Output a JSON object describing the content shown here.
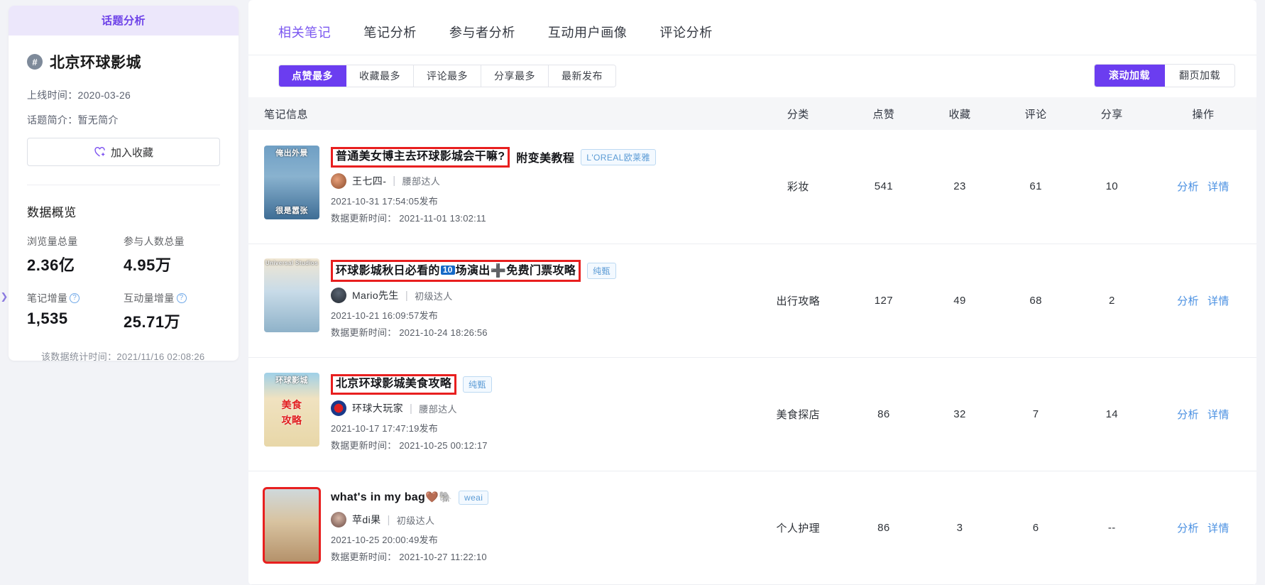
{
  "sidebar": {
    "header_title": "话题分析",
    "topic": {
      "hash_icon": "hash-icon",
      "name": "北京环球影城"
    },
    "online_time_label": "上线时间：",
    "online_time_value": "2020-03-26",
    "intro_label": "话题简介：",
    "intro_value": "暂无简介",
    "favorite_button": "加入收藏",
    "overview_title": "数据概览",
    "stats": [
      {
        "label": "浏览量总量",
        "value": "2.36亿",
        "has_help": false
      },
      {
        "label": "参与人数总量",
        "value": "4.95万",
        "has_help": false
      },
      {
        "label": "笔记增量",
        "value": "1,535",
        "has_help": true
      },
      {
        "label": "互动量增量",
        "value": "25.71万",
        "has_help": true
      }
    ],
    "stat_time_label": "该数据统计时间：",
    "stat_time_value": "2021/11/16 02:08:26",
    "collapse_icon": "chevron-right-icon"
  },
  "main": {
    "tabs": [
      {
        "label": "相关笔记",
        "active": true
      },
      {
        "label": "笔记分析",
        "active": false
      },
      {
        "label": "参与者分析",
        "active": false
      },
      {
        "label": "互动用户画像",
        "active": false
      },
      {
        "label": "评论分析",
        "active": false
      }
    ],
    "sort_buttons": [
      {
        "label": "点赞最多",
        "active": true
      },
      {
        "label": "收藏最多",
        "active": false
      },
      {
        "label": "评论最多",
        "active": false
      },
      {
        "label": "分享最多",
        "active": false
      },
      {
        "label": "最新发布",
        "active": false
      }
    ],
    "load_buttons": [
      {
        "label": "滚动加载",
        "active": true
      },
      {
        "label": "翻页加载",
        "active": false
      }
    ],
    "table": {
      "headers": [
        "笔记信息",
        "分类",
        "点赞",
        "收藏",
        "评论",
        "分享",
        "操作"
      ],
      "op_analyze": "分析",
      "op_detail": "详情",
      "publish_suffix": "发布",
      "update_label": "数据更新时间：",
      "rows": [
        {
          "thumb_caption_top": "俺出外景",
          "thumb_caption_bottom": "很是嚣张",
          "title": "普通美女博主去环球影城会干嘛?",
          "title_suffix": "附变美教程",
          "tag": "L'OREAL欧莱雅",
          "author": "王七四-",
          "author_level": "腰部达人",
          "publish_time": "2021-10-31 17:54:05",
          "update_time": "2021-11-01 13:02:11",
          "category": "彩妆",
          "likes": "541",
          "collects": "23",
          "comments": "61",
          "shares": "10"
        },
        {
          "thumb_caption_top": "Universal Studios",
          "thumb_caption_bottom": "",
          "title_pre": "环球影城秋日必看的",
          "title_badge": "10",
          "title_mid": "场演出",
          "title_plus": "➕",
          "title_post": "免费门票攻略",
          "tag": "纯甄",
          "author": "Mario先生",
          "author_level": "初级达人",
          "publish_time": "2021-10-21 16:09:57",
          "update_time": "2021-10-24 18:26:56",
          "category": "出行攻略",
          "likes": "127",
          "collects": "49",
          "comments": "68",
          "shares": "2"
        },
        {
          "thumb_caption_top": "环球影城",
          "thumb_caption_mid": "美食",
          "thumb_caption_mid2": "攻略",
          "title": "北京环球影城美食攻略",
          "tag": "纯甄",
          "author": "环球大玩家",
          "author_level": "腰部达人",
          "publish_time": "2021-10-17 17:47:19",
          "update_time": "2021-10-25 00:12:17",
          "category": "美食探店",
          "likes": "86",
          "collects": "32",
          "comments": "7",
          "shares": "14"
        },
        {
          "thumb_caption_top": "",
          "title": "what's in my bag",
          "title_emoji": "🤎🐘",
          "tag": "weai",
          "author": "苹di果",
          "author_level": "初级达人",
          "publish_time": "2021-10-25 20:00:49",
          "update_time": "2021-10-27 11:22:10",
          "category": "个人护理",
          "likes": "86",
          "collects": "3",
          "comments": "6",
          "shares": "--"
        }
      ]
    }
  },
  "colors": {
    "accent": "#6b3df0",
    "header_bg": "#ece7fb",
    "link": "#4a90e2",
    "highlight_box": "#e81f1f"
  }
}
